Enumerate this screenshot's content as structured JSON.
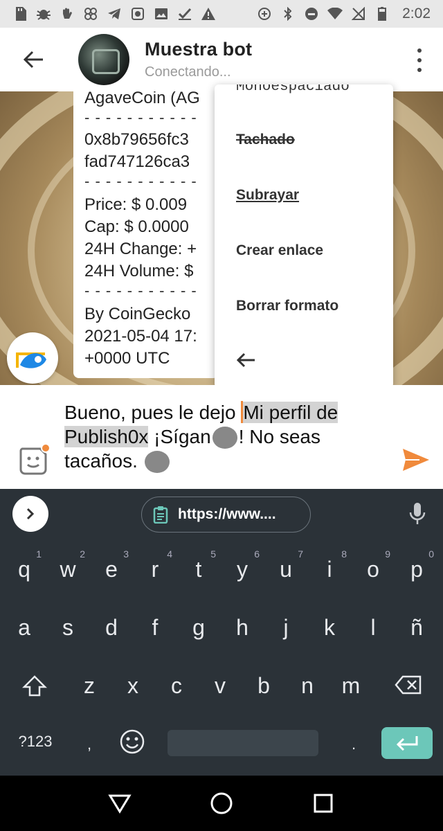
{
  "status_bar": {
    "time": "2:02"
  },
  "header": {
    "title": "Muestra bot",
    "subtitle": "Conectando..."
  },
  "message": {
    "lines": [
      "AgaveCoin (AG",
      "0x8b79656fc3",
      "fad747126ca3",
      "Price:  $ 0.009",
      "Cap:  $ 0.0000",
      "24H Change:  +",
      "24H Volume:  $",
      "By CoinGecko",
      "2021-05-04 17:",
      "+0000 UTC"
    ],
    "separator": "- - - - - - - - - - -"
  },
  "context_menu": {
    "items": [
      "Monoespaciado",
      "Tachado",
      "Subrayar",
      "Crear enlace",
      "Borrar formato"
    ]
  },
  "composer": {
    "text_before": "Bueno, pues le dejo ",
    "selected_text_1": "Mi perfil de",
    "selected_text_2": "Publish0x",
    "text_after_1": " ¡Sígan",
    "text_after_2": "! No seas",
    "text_line3": "tacaños."
  },
  "keyboard": {
    "clipboard_chip": "https://www....",
    "row1": [
      [
        "q",
        "1"
      ],
      [
        "w",
        "2"
      ],
      [
        "e",
        "3"
      ],
      [
        "r",
        "4"
      ],
      [
        "t",
        "5"
      ],
      [
        "y",
        "6"
      ],
      [
        "u",
        "7"
      ],
      [
        "i",
        "8"
      ],
      [
        "o",
        "9"
      ],
      [
        "p",
        "0"
      ]
    ],
    "row2": [
      "a",
      "s",
      "d",
      "f",
      "g",
      "h",
      "j",
      "k",
      "l",
      "ñ"
    ],
    "row3": [
      "z",
      "x",
      "c",
      "v",
      "b",
      "n",
      "m"
    ],
    "symbols_key": "?123",
    "comma_key": ",",
    "period_key": ".",
    "accent_color": "#6cc7b9"
  }
}
